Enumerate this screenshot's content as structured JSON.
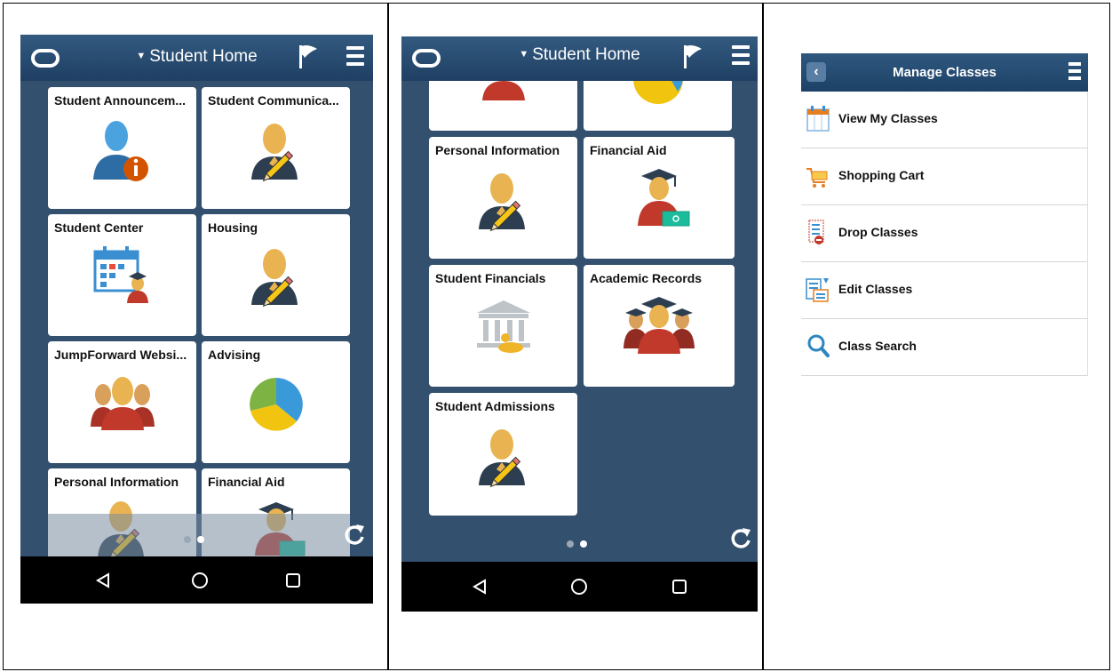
{
  "phone1": {
    "title": "Student Home",
    "tiles": [
      {
        "label": "Student Announcem..."
      },
      {
        "label": "Student Communica..."
      },
      {
        "label": "Student Center"
      },
      {
        "label": "Housing"
      },
      {
        "label": "JumpForward Websi..."
      },
      {
        "label": "Advising"
      },
      {
        "label": "Personal Information"
      },
      {
        "label": "Financial Aid"
      }
    ]
  },
  "phone2": {
    "title": "Student Home",
    "tiles": [
      {
        "label": "Personal Information"
      },
      {
        "label": "Financial Aid"
      },
      {
        "label": "Student Financials"
      },
      {
        "label": "Academic Records"
      },
      {
        "label": "Student Admissions"
      }
    ]
  },
  "manage_classes": {
    "title": "Manage Classes",
    "items": [
      {
        "label": "View My Classes",
        "icon": "calendar-icon"
      },
      {
        "label": "Shopping Cart",
        "icon": "shopping-cart-icon"
      },
      {
        "label": "Drop Classes",
        "icon": "drop-classes-icon"
      },
      {
        "label": "Edit Classes",
        "icon": "edit-classes-icon"
      },
      {
        "label": "Class Search",
        "icon": "magnifier-icon"
      }
    ]
  },
  "colors": {
    "header": "#1f3f63",
    "background": "#34506f",
    "person_head": "#e8b350",
    "person_body": "#2c3e50",
    "red": "#c0392b"
  }
}
